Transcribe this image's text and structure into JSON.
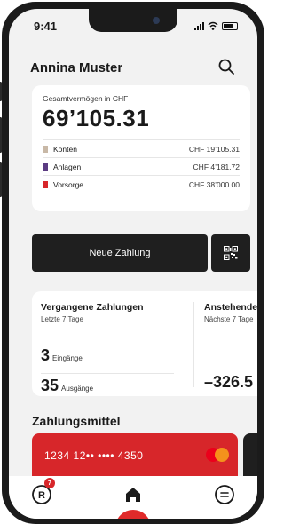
{
  "status_bar": {
    "time": "9:41"
  },
  "header": {
    "user_name": "Annina Muster"
  },
  "assets": {
    "label": "Gesamtvermögen in CHF",
    "total": "69’105.31",
    "rows": [
      {
        "label": "Konten",
        "amount": "CHF 19’105.31",
        "color": "#c8b8a6"
      },
      {
        "label": "Anlagen",
        "amount": "CHF 4’181.72",
        "color": "#5b3b82"
      },
      {
        "label": "Vorsorge",
        "amount": "CHF 38’000.00",
        "color": "#d7262a"
      }
    ]
  },
  "payment": {
    "new_payment_label": "Neue Zahlung"
  },
  "payments_overview": {
    "past": {
      "title": "Vergangene Zahlungen",
      "subtitle": "Letzte 7 Tage",
      "incoming_count": "3",
      "incoming_label": "Eingänge",
      "outgoing_count": "35",
      "outgoing_label": "Ausgänge"
    },
    "upcoming": {
      "title": "Anstehende",
      "subtitle": "Nächste 7 Tage",
      "amount": "–326.5"
    }
  },
  "payment_means": {
    "title": "Zahlungsmittel",
    "card_number": "1234 12•• •••• 4350"
  },
  "tabbar": {
    "badge_count": "7"
  },
  "colors": {
    "accent": "#d7262a",
    "dark": "#1f1f1f",
    "background": "#f2f2f2"
  }
}
